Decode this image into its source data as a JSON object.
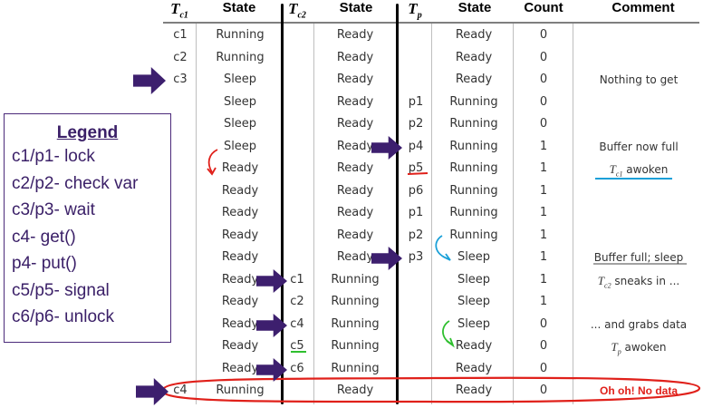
{
  "headers": {
    "tc1": "T",
    "tc1_sub": "c1",
    "state1": "State",
    "tc2": "T",
    "tc2_sub": "c2",
    "state2": "State",
    "tp": "T",
    "tp_sub": "p",
    "state3": "State",
    "count": "Count",
    "comment": "Comment"
  },
  "rows": [
    {
      "tc1": "c1",
      "s1": "Running",
      "tc2": "",
      "s2": "Ready",
      "tp": "",
      "s3": "Ready",
      "count": "0",
      "comment": ""
    },
    {
      "tc1": "c2",
      "s1": "Running",
      "tc2": "",
      "s2": "Ready",
      "tp": "",
      "s3": "Ready",
      "count": "0",
      "comment": ""
    },
    {
      "tc1": "c3",
      "s1": "Sleep",
      "tc2": "",
      "s2": "Ready",
      "tp": "",
      "s3": "Ready",
      "count": "0",
      "comment": "Nothing to get"
    },
    {
      "tc1": "",
      "s1": "Sleep",
      "tc2": "",
      "s2": "Ready",
      "tp": "p1",
      "s3": "Running",
      "count": "0",
      "comment": ""
    },
    {
      "tc1": "",
      "s1": "Sleep",
      "tc2": "",
      "s2": "Ready",
      "tp": "p2",
      "s3": "Running",
      "count": "0",
      "comment": ""
    },
    {
      "tc1": "",
      "s1": "Sleep",
      "tc2": "",
      "s2": "Ready",
      "tp": "p4",
      "s3": "Running",
      "count": "1",
      "comment": "Buffer now full"
    },
    {
      "tc1": "",
      "s1": "Ready",
      "tc2": "",
      "s2": "Ready",
      "tp": "p5",
      "s3": "Running",
      "count": "1",
      "comment": "awoken",
      "comment_prefix": "T",
      "comment_sub": "c1"
    },
    {
      "tc1": "",
      "s1": "Ready",
      "tc2": "",
      "s2": "Ready",
      "tp": "p6",
      "s3": "Running",
      "count": "1",
      "comment": ""
    },
    {
      "tc1": "",
      "s1": "Ready",
      "tc2": "",
      "s2": "Ready",
      "tp": "p1",
      "s3": "Running",
      "count": "1",
      "comment": ""
    },
    {
      "tc1": "",
      "s1": "Ready",
      "tc2": "",
      "s2": "Ready",
      "tp": "p2",
      "s3": "Running",
      "count": "1",
      "comment": ""
    },
    {
      "tc1": "",
      "s1": "Ready",
      "tc2": "",
      "s2": "Ready",
      "tp": "p3",
      "s3": "Sleep",
      "count": "1",
      "comment": "Buffer full; sleep"
    },
    {
      "tc1": "",
      "s1": "Ready",
      "tc2": "c1",
      "s2": "Running",
      "tp": "",
      "s3": "Sleep",
      "count": "1",
      "comment": "sneaks in ...",
      "comment_prefix": "T",
      "comment_sub": "c2"
    },
    {
      "tc1": "",
      "s1": "Ready",
      "tc2": "c2",
      "s2": "Running",
      "tp": "",
      "s3": "Sleep",
      "count": "1",
      "comment": ""
    },
    {
      "tc1": "",
      "s1": "Ready",
      "tc2": "c4",
      "s2": "Running",
      "tp": "",
      "s3": "Sleep",
      "count": "0",
      "comment": "... and grabs data"
    },
    {
      "tc1": "",
      "s1": "Ready",
      "tc2": "c5",
      "s2": "Running",
      "tp": "",
      "s3": "Ready",
      "count": "0",
      "comment": "awoken",
      "comment_prefix": "T",
      "comment_sub": "p"
    },
    {
      "tc1": "",
      "s1": "Ready",
      "tc2": "c6",
      "s2": "Running",
      "tp": "",
      "s3": "Ready",
      "count": "0",
      "comment": ""
    },
    {
      "tc1": "c4",
      "s1": "Running",
      "tc2": "",
      "s2": "Ready",
      "tp": "",
      "s3": "Ready",
      "count": "0",
      "comment": "Oh oh! No data"
    }
  ],
  "legend": {
    "title": "Legend",
    "items": [
      "c1/p1- lock",
      "c2/p2- check var",
      "c3/p3- wait",
      "c4- get()",
      "p4- put()",
      "c5/p5- signal",
      "c6/p6- unlock"
    ]
  },
  "colors": {
    "arrow": "#3d1f6e",
    "red": "#e0201a",
    "cyan": "#1aa0d8",
    "green": "#2fbf2f",
    "legend_text": "#3b2068"
  }
}
